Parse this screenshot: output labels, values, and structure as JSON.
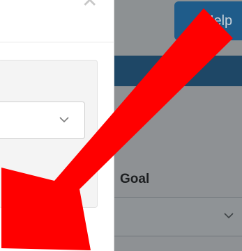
{
  "background": {
    "help_button_label": "Help",
    "goal_label": "Goal"
  },
  "modal": {
    "close_icon": "close-icon"
  },
  "annotation": {
    "arrow_color": "#ff0000"
  }
}
